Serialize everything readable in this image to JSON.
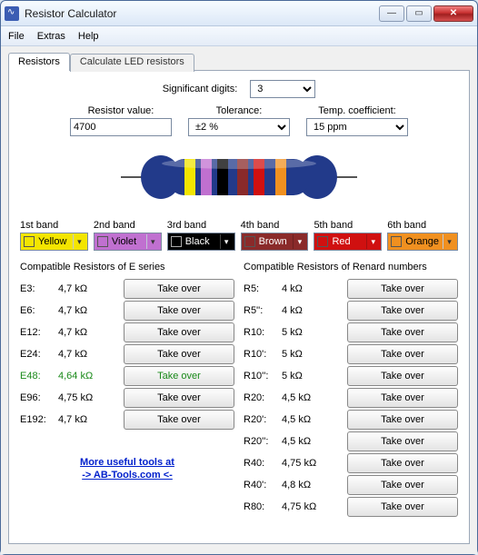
{
  "window": {
    "title": "Resistor Calculator"
  },
  "menu": {
    "file": "File",
    "extras": "Extras",
    "help": "Help"
  },
  "tabs": {
    "resistors": "Resistors",
    "led": "Calculate LED resistors"
  },
  "sig": {
    "label": "Significant digits:",
    "value": "3"
  },
  "inputs": {
    "value_label": "Resistor value:",
    "value": "4700",
    "tol_label": "Tolerance:",
    "tol": "±2 %",
    "tc_label": "Temp. coefficient:",
    "tc": "15 ppm"
  },
  "bands": {
    "b1": {
      "label": "1st band",
      "name": "Yellow",
      "color": "#f3e500"
    },
    "b2": {
      "label": "2nd band",
      "name": "Violet",
      "color": "#c070d0"
    },
    "b3": {
      "label": "3rd band",
      "name": "Black",
      "color": "#000000"
    },
    "b4": {
      "label": "4th band",
      "name": "Brown",
      "color": "#8a2a2a"
    },
    "b5": {
      "label": "5th band",
      "name": "Red",
      "color": "#d01010"
    },
    "b6": {
      "label": "6th band",
      "name": "Orange",
      "color": "#f09020"
    }
  },
  "eseries": {
    "title": "Compatible Resistors of E series",
    "rows": [
      {
        "series": "E3:",
        "val": "4,7 kΩ",
        "btn": "Take over",
        "hl": false
      },
      {
        "series": "E6:",
        "val": "4,7 kΩ",
        "btn": "Take over",
        "hl": false
      },
      {
        "series": "E12:",
        "val": "4,7 kΩ",
        "btn": "Take over",
        "hl": false
      },
      {
        "series": "E24:",
        "val": "4,7 kΩ",
        "btn": "Take over",
        "hl": false
      },
      {
        "series": "E48:",
        "val": "4,64 kΩ",
        "btn": "Take over",
        "hl": true
      },
      {
        "series": "E96:",
        "val": "4,75 kΩ",
        "btn": "Take over",
        "hl": false
      },
      {
        "series": "E192:",
        "val": "4,7 kΩ",
        "btn": "Take over",
        "hl": false
      }
    ]
  },
  "renard": {
    "title": "Compatible Resistors of Renard numbers",
    "rows": [
      {
        "series": "R5:",
        "val": "4 kΩ",
        "btn": "Take over"
      },
      {
        "series": "R5'':",
        "val": "4 kΩ",
        "btn": "Take over"
      },
      {
        "series": "R10:",
        "val": "5 kΩ",
        "btn": "Take over"
      },
      {
        "series": "R10':",
        "val": "5 kΩ",
        "btn": "Take over"
      },
      {
        "series": "R10'':",
        "val": "5 kΩ",
        "btn": "Take over"
      },
      {
        "series": "R20:",
        "val": "4,5 kΩ",
        "btn": "Take over"
      },
      {
        "series": "R20':",
        "val": "4,5 kΩ",
        "btn": "Take over"
      },
      {
        "series": "R20'':",
        "val": "4,5 kΩ",
        "btn": "Take over"
      },
      {
        "series": "R40:",
        "val": "4,75 kΩ",
        "btn": "Take over"
      },
      {
        "series": "R40':",
        "val": "4,8 kΩ",
        "btn": "Take over"
      },
      {
        "series": "R80:",
        "val": "4,75 kΩ",
        "btn": "Take over"
      }
    ]
  },
  "footer": {
    "line1": "More useful tools at",
    "line2": "-> AB-Tools.com <-"
  }
}
